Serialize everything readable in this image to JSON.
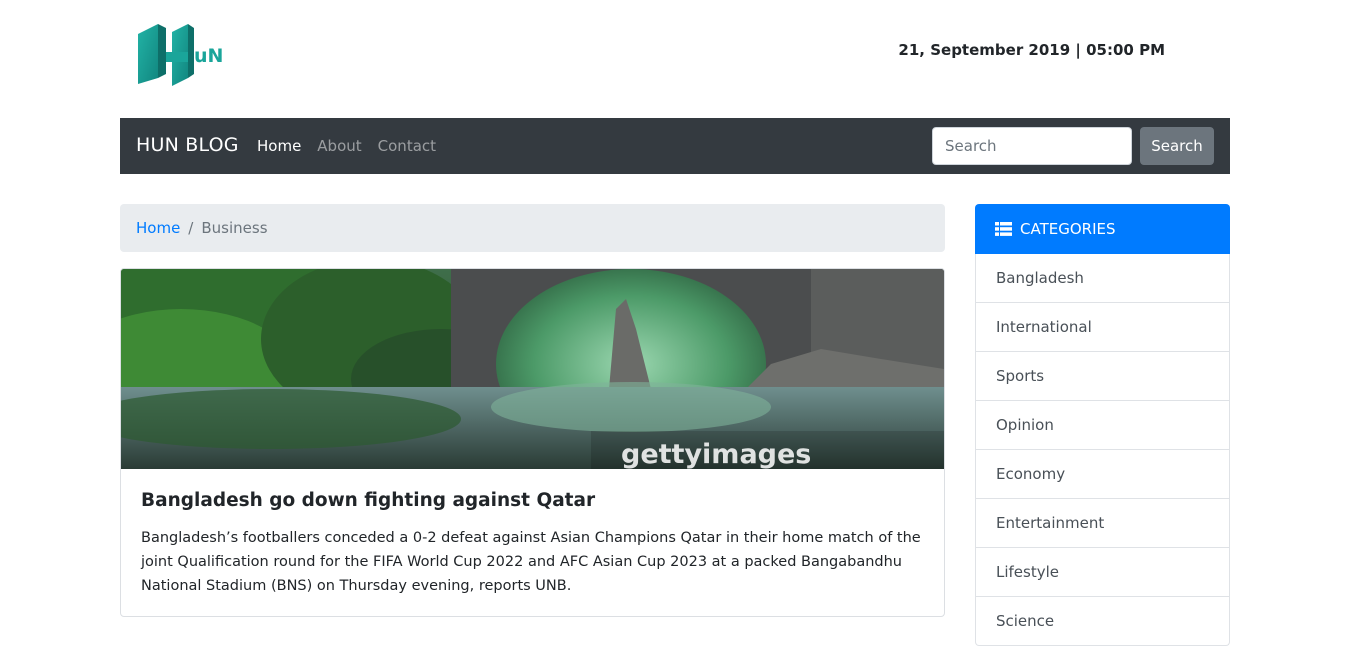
{
  "header": {
    "datetime": "21, September 2019 | 05:00 PM"
  },
  "navbar": {
    "brand": "HUN BLOG",
    "links": [
      {
        "label": "Home",
        "active": true
      },
      {
        "label": "About",
        "active": false
      },
      {
        "label": "Contact",
        "active": false
      }
    ],
    "search_placeholder": "Search",
    "search_button": "Search"
  },
  "breadcrumb": {
    "home": "Home",
    "separator": "/",
    "current": "Business"
  },
  "article": {
    "image_watermark": "gettyimages",
    "title": "Bangladesh go down fighting against Qatar",
    "body": "Bangladesh’s footballers conceded a 0-2 defeat against Asian Champions Qatar in their home match of the joint Qualification round for the FIFA World Cup 2022 and AFC Asian Cup 2023 at a packed Bangabandhu National Stadium (BNS) on Thursday evening, reports UNB."
  },
  "categories": {
    "icon": "list-icon",
    "heading": "CATEGORIES",
    "items": [
      "Bangladesh",
      "International",
      "Sports",
      "Opinion",
      "Economy",
      "Entertainment",
      "Lifestyle",
      "Science"
    ]
  },
  "colors": {
    "navbar_bg": "#343a40",
    "accent_blue": "#007bff",
    "logo_teal": "#1aa59a"
  }
}
